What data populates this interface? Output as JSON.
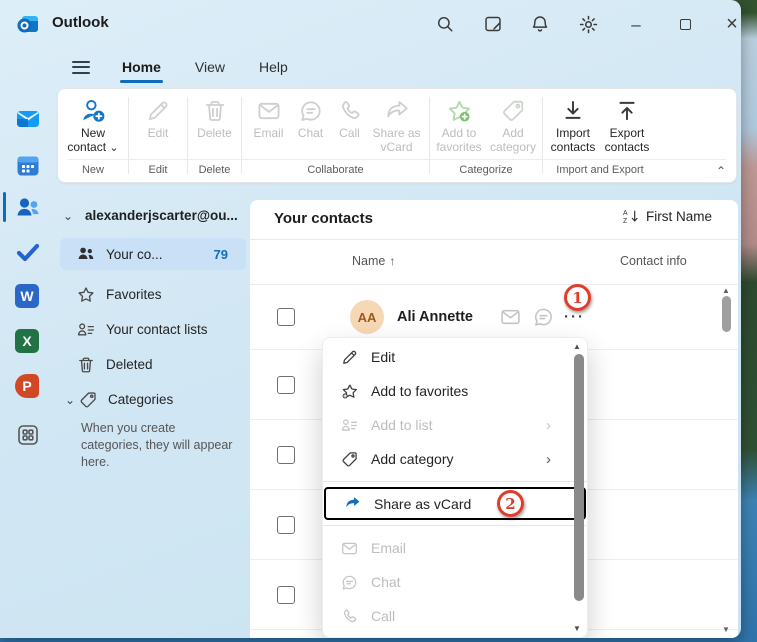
{
  "titlebar": {
    "app_name": "Outlook"
  },
  "menubar": {
    "tabs": [
      {
        "label": "Home"
      },
      {
        "label": "View"
      },
      {
        "label": "Help"
      }
    ]
  },
  "ribbon": {
    "groups": [
      {
        "label": "New",
        "items": [
          {
            "label": "New contact"
          }
        ]
      },
      {
        "label": "Edit",
        "items": [
          {
            "label": "Edit"
          }
        ]
      },
      {
        "label": "Delete",
        "items": [
          {
            "label": "Delete"
          }
        ]
      },
      {
        "label": "Collaborate",
        "items": [
          {
            "label": "Email"
          },
          {
            "label": "Chat"
          },
          {
            "label": "Call"
          },
          {
            "label": "Share as vCard"
          }
        ]
      },
      {
        "label": "Categorize",
        "items": [
          {
            "label": "Add to favorites"
          },
          {
            "label": "Add category"
          }
        ]
      },
      {
        "label": "Import and Export",
        "items": [
          {
            "label": "Import contacts"
          },
          {
            "label": "Export contacts"
          }
        ]
      }
    ]
  },
  "app_rail": {
    "word_letter": "W",
    "excel_letter": "X",
    "powerpoint_letter": "P"
  },
  "sidebar": {
    "account": "alexanderjscarter@ou...",
    "items": [
      {
        "label": "Your co...",
        "count": "79"
      },
      {
        "label": "Favorites"
      },
      {
        "label": "Your contact lists"
      },
      {
        "label": "Deleted"
      },
      {
        "label": "Categories"
      }
    ],
    "empty_hint": "When you create categories, they will appear here."
  },
  "main": {
    "title": "Your contacts",
    "sort_label": "First Name",
    "columns": {
      "name": "Name",
      "info": "Contact info"
    },
    "contact": {
      "initials": "AA",
      "name": "Ali Annette"
    }
  },
  "context_menu": {
    "items": [
      {
        "label": "Edit"
      },
      {
        "label": "Add to favorites"
      },
      {
        "label": "Add to list"
      },
      {
        "label": "Add category"
      },
      {
        "label": "Share as vCard"
      },
      {
        "label": "Email"
      },
      {
        "label": "Chat"
      },
      {
        "label": "Call"
      }
    ]
  },
  "annotations": {
    "step1": "1",
    "step2": "2"
  },
  "icons": {
    "chevron_down": "⌄",
    "chevron_right": "›",
    "more": "···",
    "scroll_up": "▲",
    "scroll_down": "▼",
    "sort_asc": "↑",
    "minimize": "–",
    "close": "×",
    "collapse": "⌃",
    "sort_a": "A",
    "sort_z": "Z"
  },
  "colors": {
    "accent": "#0f6cbd",
    "annotation": "#df3d2c",
    "selected_pill": "#c9e0f6"
  }
}
